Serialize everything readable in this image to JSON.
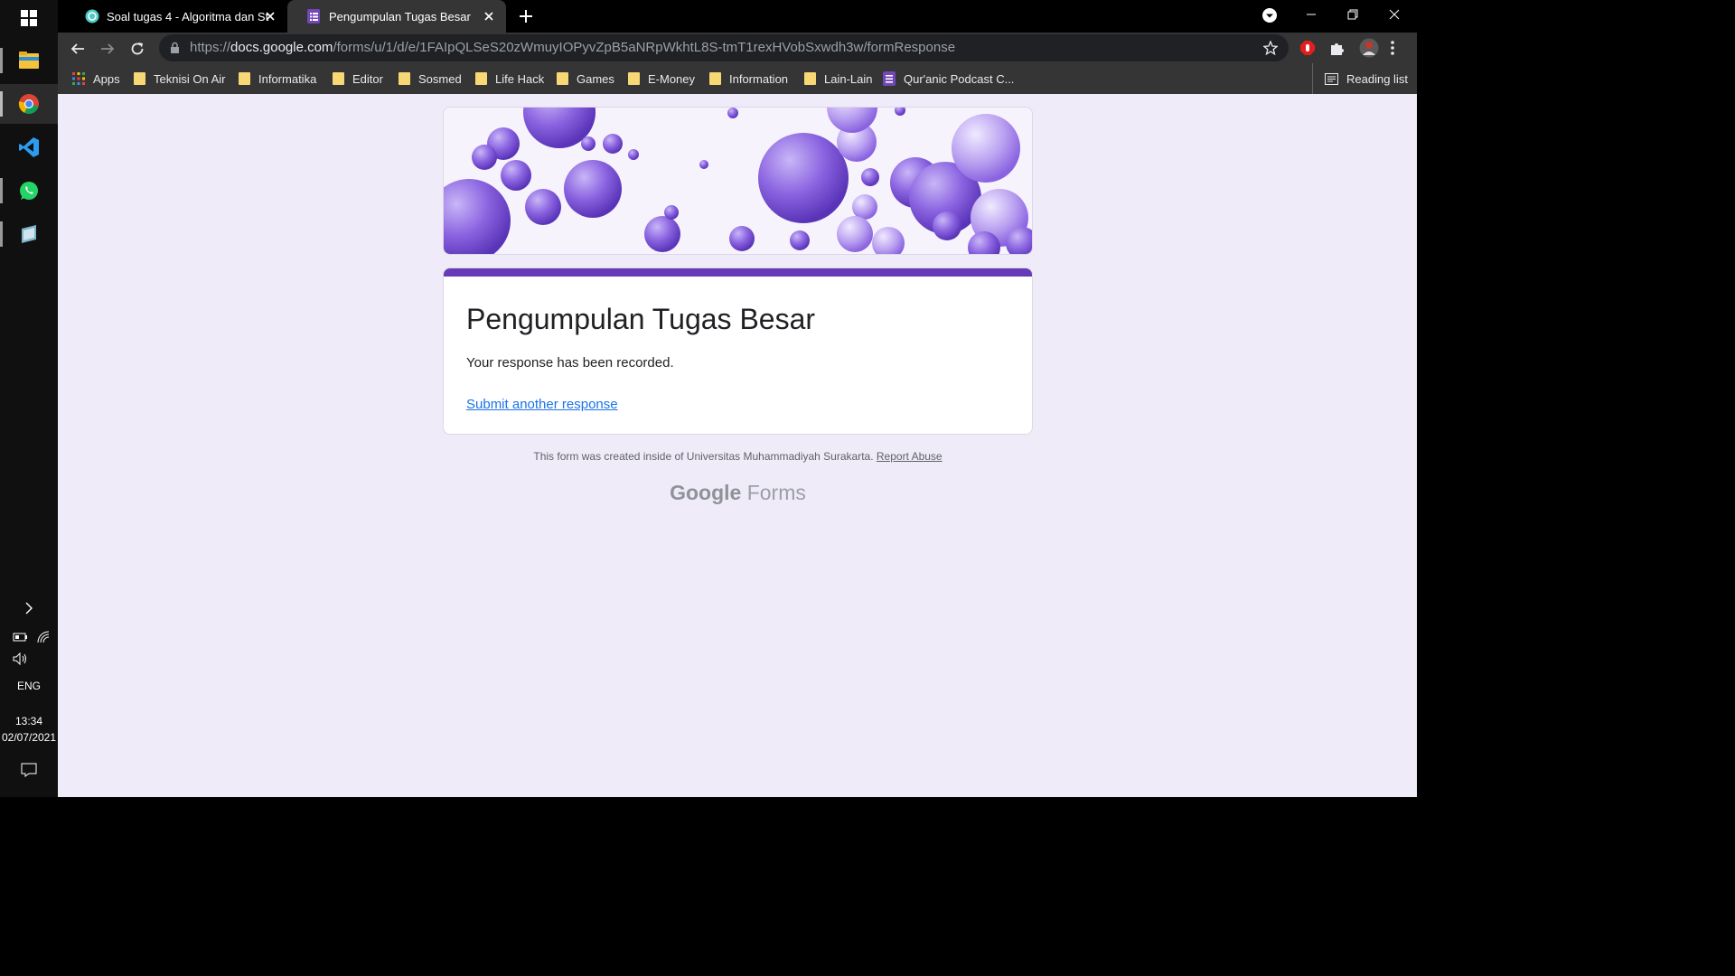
{
  "taskbar": {
    "apps": [
      {
        "name": "file-explorer",
        "active": false
      },
      {
        "name": "chrome",
        "active": true
      },
      {
        "name": "vscode",
        "active": false
      },
      {
        "name": "whatsapp",
        "active": false
      },
      {
        "name": "app",
        "active": false
      }
    ],
    "language": "ENG",
    "time": "13:34",
    "date": "02/07/2021"
  },
  "browser": {
    "tabs": [
      {
        "title": "Soal tugas 4 - Algoritma dan Stru",
        "active": false
      },
      {
        "title": "Pengumpulan Tugas Besar",
        "active": true
      }
    ],
    "url": {
      "scheme": "https://",
      "host": "docs.google.com",
      "path": "/forms/u/1/d/e/1FAIpQLSeS20zWmuyIOPyvZpB5aNRpWkhtL8S-tmT1rexHVobSxwdh3w/formResponse"
    },
    "bookmarks": [
      {
        "label": "Apps",
        "icon": "apps-grid-icon"
      },
      {
        "label": "Teknisi On Air",
        "icon": "folder-icon"
      },
      {
        "label": "Informatika",
        "icon": "folder-icon"
      },
      {
        "label": "Editor",
        "icon": "folder-icon"
      },
      {
        "label": "Sosmed",
        "icon": "folder-icon"
      },
      {
        "label": "Life Hack",
        "icon": "folder-icon"
      },
      {
        "label": "Games",
        "icon": "folder-icon"
      },
      {
        "label": "E-Money",
        "icon": "folder-icon"
      },
      {
        "label": "Information",
        "icon": "folder-icon"
      },
      {
        "label": "Lain-Lain",
        "icon": "folder-icon"
      },
      {
        "label": "Qur'anic Podcast C...",
        "icon": "forms-icon"
      }
    ],
    "reading_list": "Reading list"
  },
  "form": {
    "title": "Pengumpulan Tugas Besar",
    "message": "Your response has been recorded.",
    "link": "Submit another response",
    "accent_color": "#673ab7",
    "footer_text": "This form was created inside of Universitas Muhammadiyah Surakarta.",
    "report_abuse": "Report Abuse",
    "brand_google": "Google",
    "brand_forms": "Forms"
  }
}
